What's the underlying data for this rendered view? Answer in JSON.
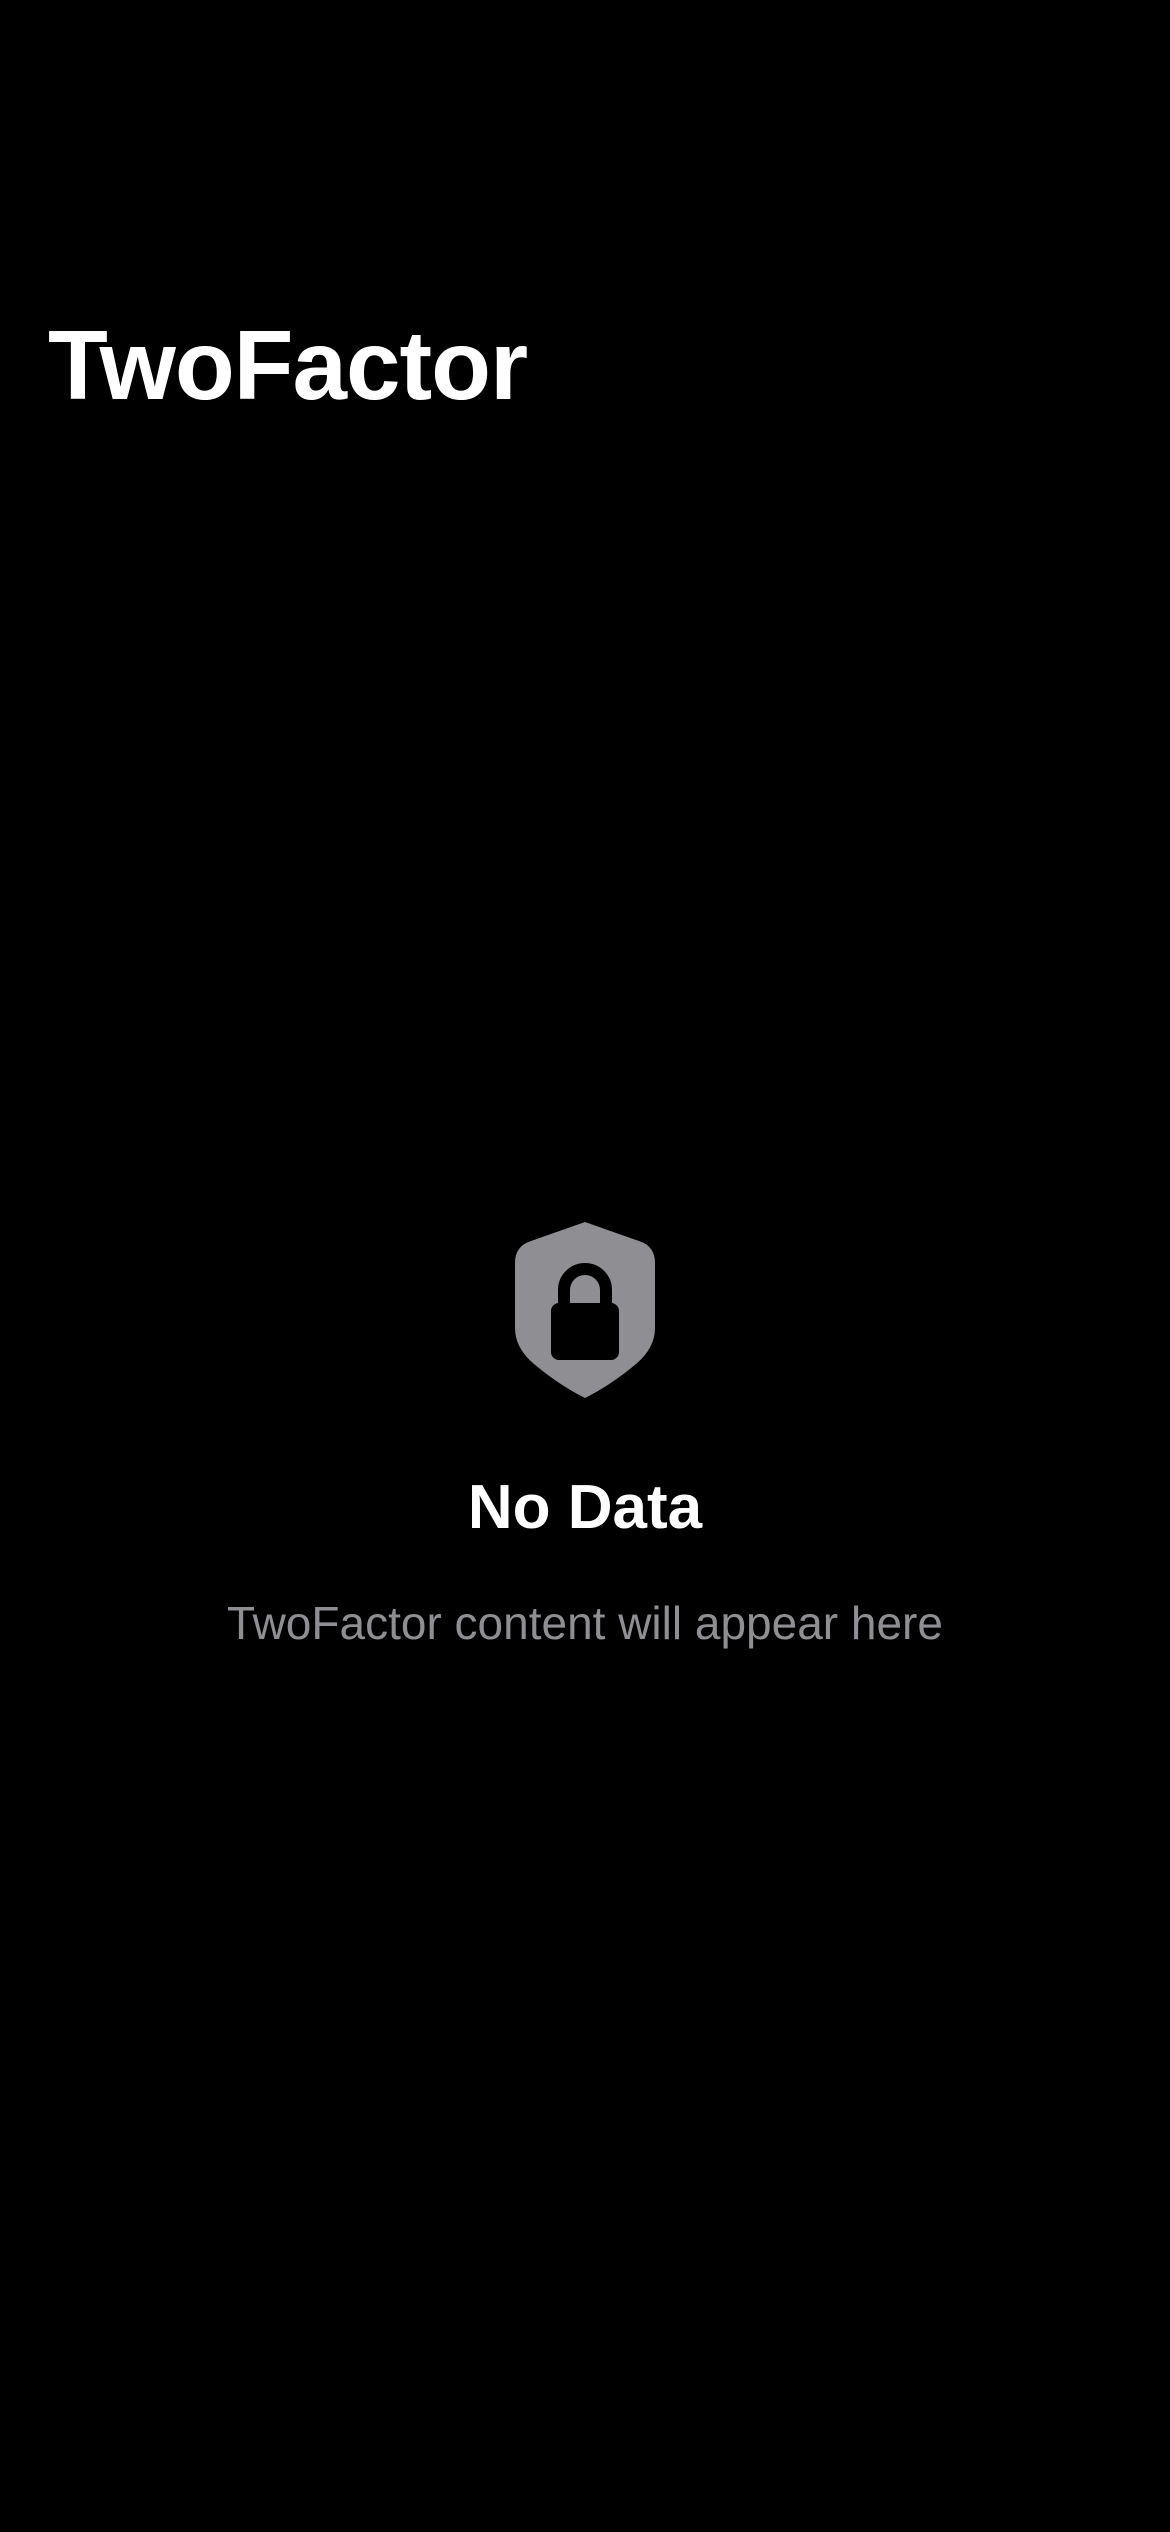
{
  "header": {
    "title": "TwoFactor"
  },
  "empty_state": {
    "icon": "lock-shield-icon",
    "title": "No Data",
    "subtitle": "TwoFactor content will appear here",
    "icon_color": "#8e8e93",
    "subtitle_color": "#8e8e93"
  },
  "theme": {
    "background": "#000000",
    "text": "#ffffff"
  }
}
